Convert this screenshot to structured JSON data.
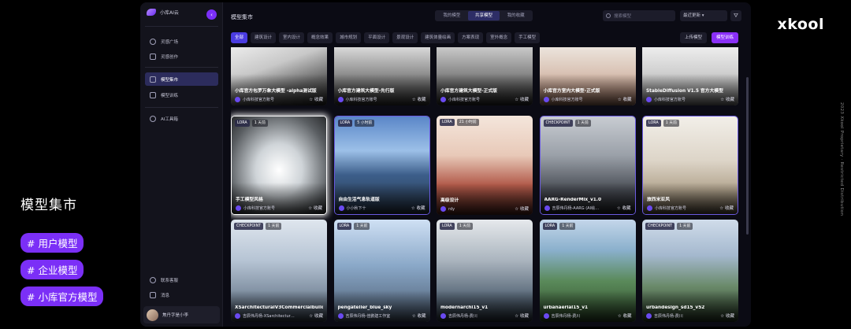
{
  "slide": {
    "title": "模型集市",
    "tags": [
      "# 用户模型",
      "# 企业模型",
      "# 小库官方模型"
    ],
    "brand": "xkool",
    "vertical_note": "2023 Xkool Proprietary  ·  Restricted Distribution"
  },
  "sidebar": {
    "app_name": "小库AI云",
    "collapse_icon": "chevron-left-icon",
    "items": [
      {
        "label": "灵感广场",
        "icon": "compass-icon"
      },
      {
        "label": "灵感创作",
        "icon": "sparkle-icon"
      },
      {
        "label": "模型集市",
        "icon": "cube-icon"
      },
      {
        "label": "模型训练",
        "icon": "flask-icon"
      },
      {
        "label": "AI工具箱",
        "icon": "toolbox-icon"
      }
    ],
    "bottom_items": [
      {
        "label": "联系客服",
        "icon": "headset-icon"
      },
      {
        "label": "消息",
        "icon": "message-icon"
      }
    ],
    "user_name": "焦丹字是小李"
  },
  "header": {
    "title": "模型集市",
    "segments": [
      "我的模型",
      "共享模型",
      "我的收藏"
    ],
    "active_segment": "共享模型",
    "search_placeholder": "搜索模型",
    "sort_label": "最近更新",
    "filter_icon": "filter-icon"
  },
  "filters": {
    "chips": [
      "全部",
      "建筑设计",
      "室内设计",
      "概念效果",
      "城市规划",
      "平面设计",
      "景观设计",
      "建筑体量绘画",
      "方案表现",
      "室外概念",
      "手工模型"
    ],
    "active": "全部"
  },
  "actions": {
    "upload_label": "上传模型",
    "train_label": "模型训练"
  },
  "cards": [
    {
      "name": "小库官方包罗万象大模型 -alpha测试版",
      "author": "小库科技官方账号",
      "fav": "收藏",
      "type": "",
      "time": "",
      "theme": "a"
    },
    {
      "name": "小库官方建筑大模型-先行版",
      "author": "小库科技官方账号",
      "fav": "收藏",
      "type": "",
      "time": "",
      "theme": "b"
    },
    {
      "name": "小库官方建筑大模型-正式版",
      "author": "小库科技官方账号",
      "fav": "收藏",
      "type": "",
      "time": "",
      "theme": "c"
    },
    {
      "name": "小库官方室内大模型-正式版",
      "author": "小库科技官方账号",
      "fav": "收藏",
      "type": "",
      "time": "",
      "theme": "d"
    },
    {
      "name": "StableDiffusion V1.5 官方大模型",
      "author": "小库科技官方账号",
      "fav": "收藏",
      "type": "",
      "time": "",
      "theme": "e"
    },
    {
      "name": "手工模型风格",
      "author": "小库科技官方账号",
      "fav": "收藏",
      "type": "LORA",
      "time": "1 天前",
      "theme": "f"
    },
    {
      "name": "自由生活气息轨道版",
      "author": "小小秋下十",
      "fav": "收藏",
      "type": "LORA",
      "time": "5 小时前",
      "theme": "g"
    },
    {
      "name": "高级设计",
      "author": "rdy",
      "fav": "收藏",
      "type": "LORA",
      "time": "21 小时前",
      "theme": "h"
    },
    {
      "name": "AARG-RenderMix_v1.0",
      "author": "吉辰伟丹杨-AARG (AI绘…",
      "fav": "收藏",
      "type": "CHECKPOINT",
      "time": "1 天前",
      "theme": "i"
    },
    {
      "name": "旅西米亚风",
      "author": "小库科技官方账号",
      "fav": "收藏",
      "type": "LORA",
      "time": "1 天前",
      "theme": "j"
    },
    {
      "name": "XSarchitecturalV3CommercialbuildI",
      "author": "吉辰伟丹杨-XSarchitectur…",
      "fav": "收藏",
      "type": "CHECKPOINT",
      "time": "1 天前",
      "theme": "k"
    },
    {
      "name": "pengatelier_blue_sky",
      "author": "吉辰伟丹杨-佳鹏建工作室",
      "fav": "收藏",
      "type": "LORA",
      "time": "1 天前",
      "theme": "l"
    },
    {
      "name": "modernarchi15_v1",
      "author": "吉辰伟丹杨-费川",
      "fav": "收藏",
      "type": "LORA",
      "time": "1 天前",
      "theme": "m"
    },
    {
      "name": "urbanaerial15_v1",
      "author": "吉辰伟丹杨-费川",
      "fav": "收藏",
      "type": "LORA",
      "time": "1 天前",
      "theme": "n"
    },
    {
      "name": "urbandesign_sd15_v52",
      "author": "吉辰伟丹杨-费川",
      "fav": "收藏",
      "type": "CHECKPOINT",
      "time": "1 天前",
      "theme": "o"
    }
  ],
  "colors": {
    "accent": "#7b2ff7",
    "active_nav": "#2c2c5c",
    "app_bg": "#0b0b14"
  }
}
